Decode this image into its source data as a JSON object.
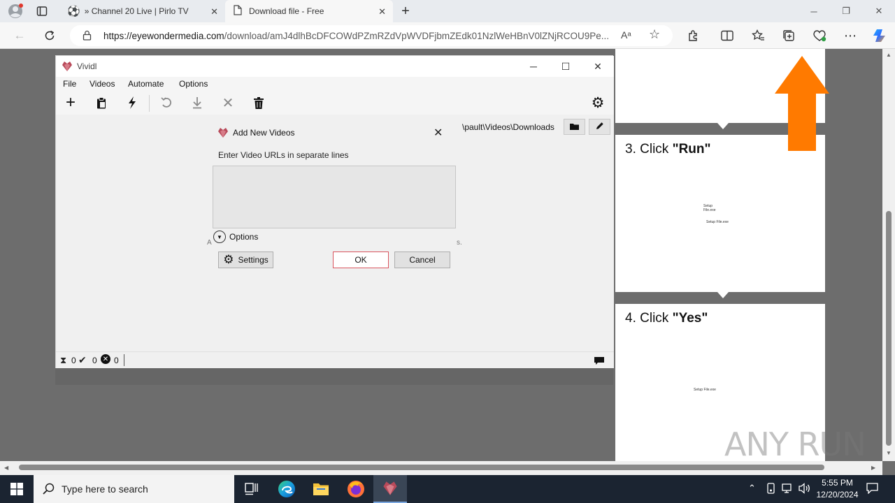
{
  "browser": {
    "tabs": [
      {
        "label": "» Channel 20 Live | Pirlo TV",
        "active": false
      },
      {
        "label": "Download file - Free",
        "active": true
      }
    ],
    "url_host": "https://eyewondermedia.com",
    "url_path": "/download/amJ4dlhBcDFCOWdPZmRZdVpWVDFjbmZEdk01NzlWeHBnV0lZNjRCOU9Pe...",
    "read_aloud_label": "Aᵃ"
  },
  "vividl": {
    "title": "Vividl",
    "menu": [
      "File",
      "Videos",
      "Automate",
      "Options"
    ],
    "download_path": "rs\\pault\\Videos\\Downloads",
    "status": {
      "pending": "0",
      "done": "0",
      "failed": "0"
    }
  },
  "dialog": {
    "title": "Add New Videos",
    "prompt": "Enter Video URLs in separate lines",
    "textarea_value": "",
    "options_label": "Options",
    "settings_label": "Settings",
    "ok_label": "OK",
    "cancel_label": "Cancel",
    "stray_left": "A",
    "stray_right": "s."
  },
  "instructions": {
    "step3_prefix": "3. Click ",
    "step3_target": "\"Run\"",
    "step3_thumb_a": "Setup",
    "step3_thumb_b": "File.exe",
    "step3_thumb_c": "Setup File.exe",
    "step4_prefix": "4. Click ",
    "step4_target": "\"Yes\"",
    "step4_thumb": "Setup File.exe",
    "arrow_color": "#ff7a00"
  },
  "watermark": "ANY RUN",
  "taskbar": {
    "search_placeholder": "Type here to search",
    "time": "5:55 PM",
    "date": "12/20/2024"
  }
}
